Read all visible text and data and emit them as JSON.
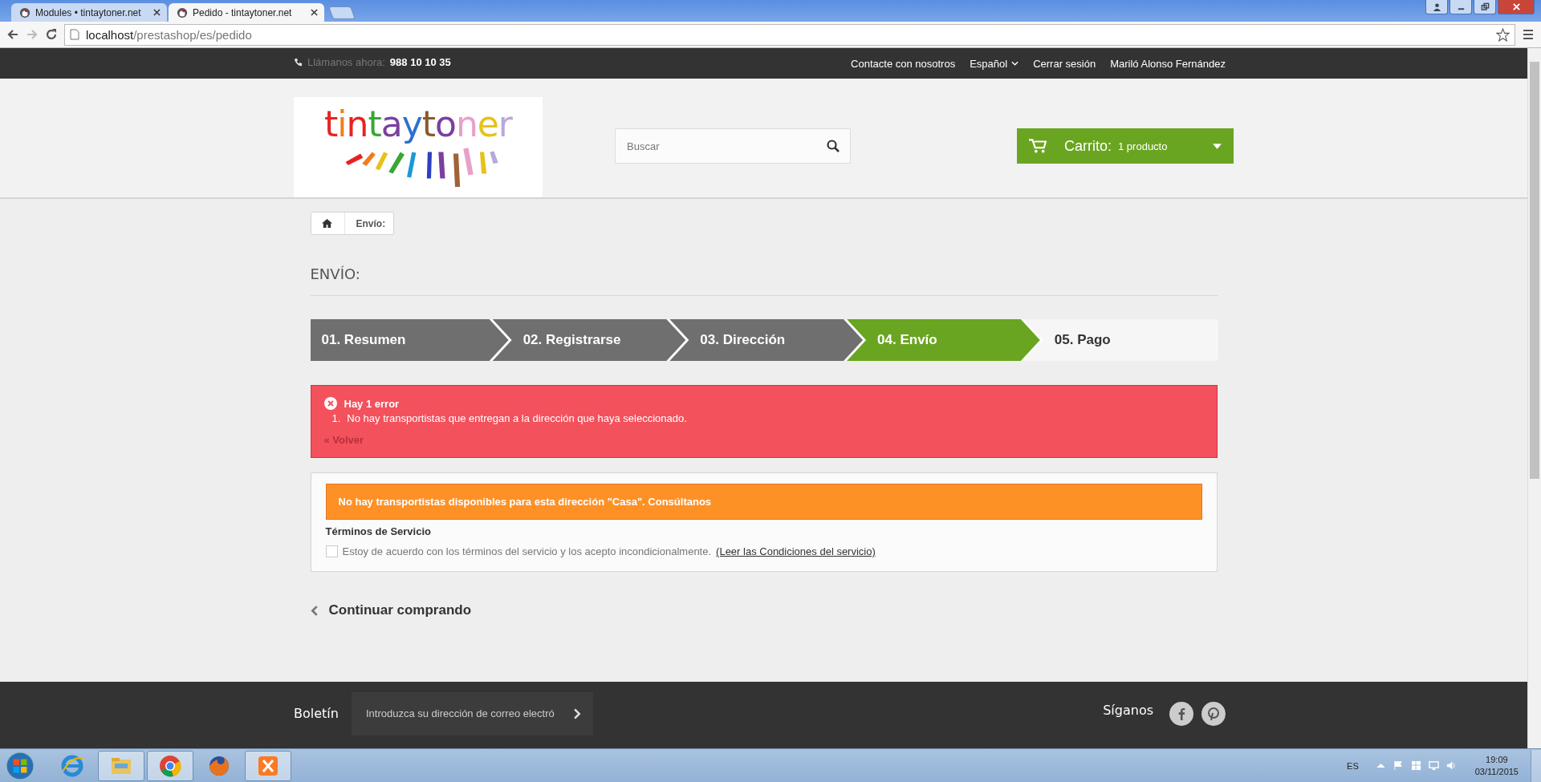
{
  "browser": {
    "tabs": [
      {
        "label": "Modules • tintaytoner.net",
        "selected": false
      },
      {
        "label": "Pedido - tintaytoner.net",
        "selected": true
      }
    ],
    "address": {
      "host": "localhost",
      "path": "/prestashop/es/pedido"
    }
  },
  "top_bar": {
    "phone_label": "Llámanos ahora:",
    "phone": "988 10 10 35",
    "links": [
      "Contacte con nosotros",
      "Español",
      "Cerrar sesión",
      "Mariló Alonso Fernández"
    ]
  },
  "header": {
    "logo": "tintaytoner",
    "search": {
      "placeholder": "Buscar"
    },
    "cart": {
      "label": "Carrito:",
      "count": "1 producto"
    }
  },
  "breadcrumb": {
    "current": "Envío:"
  },
  "heading": "ENVÍO:",
  "steps": [
    {
      "label": "01. Resumen",
      "completed": true,
      "selected": false
    },
    {
      "label": "02. Registrarse",
      "completed": true,
      "selected": false
    },
    {
      "label": "03. Dirección",
      "completed": true,
      "selected": false
    },
    {
      "label": "04. Envío",
      "completed": false,
      "selected": true
    },
    {
      "label": "05. Pago",
      "completed": false,
      "selected": false
    }
  ],
  "error": {
    "title": "Hay 1 error",
    "items": [
      {
        "number": "1.",
        "text": "No hay transportistas que entregan a la dirección que haya seleccionado."
      }
    ],
    "back": "« Volver"
  },
  "warning": "No hay transportistas disponibles para esta dirección \"Casa\". Consúltanos",
  "terms": {
    "title": "Términos de Servicio",
    "text": "Estoy de acuerdo con los términos del servicio y los acepto incondicionalmente.",
    "link": "(Leer las Condiciones del servicio)",
    "checked": false
  },
  "continue": "Continuar comprando",
  "footer": {
    "newsletter": "Boletín",
    "email_placeholder": "Introduzca su dirección de correo electró",
    "follow": "Síganos"
  },
  "taskbar": {
    "language": "ES",
    "time": "19:09",
    "date": "03/11/2015"
  }
}
